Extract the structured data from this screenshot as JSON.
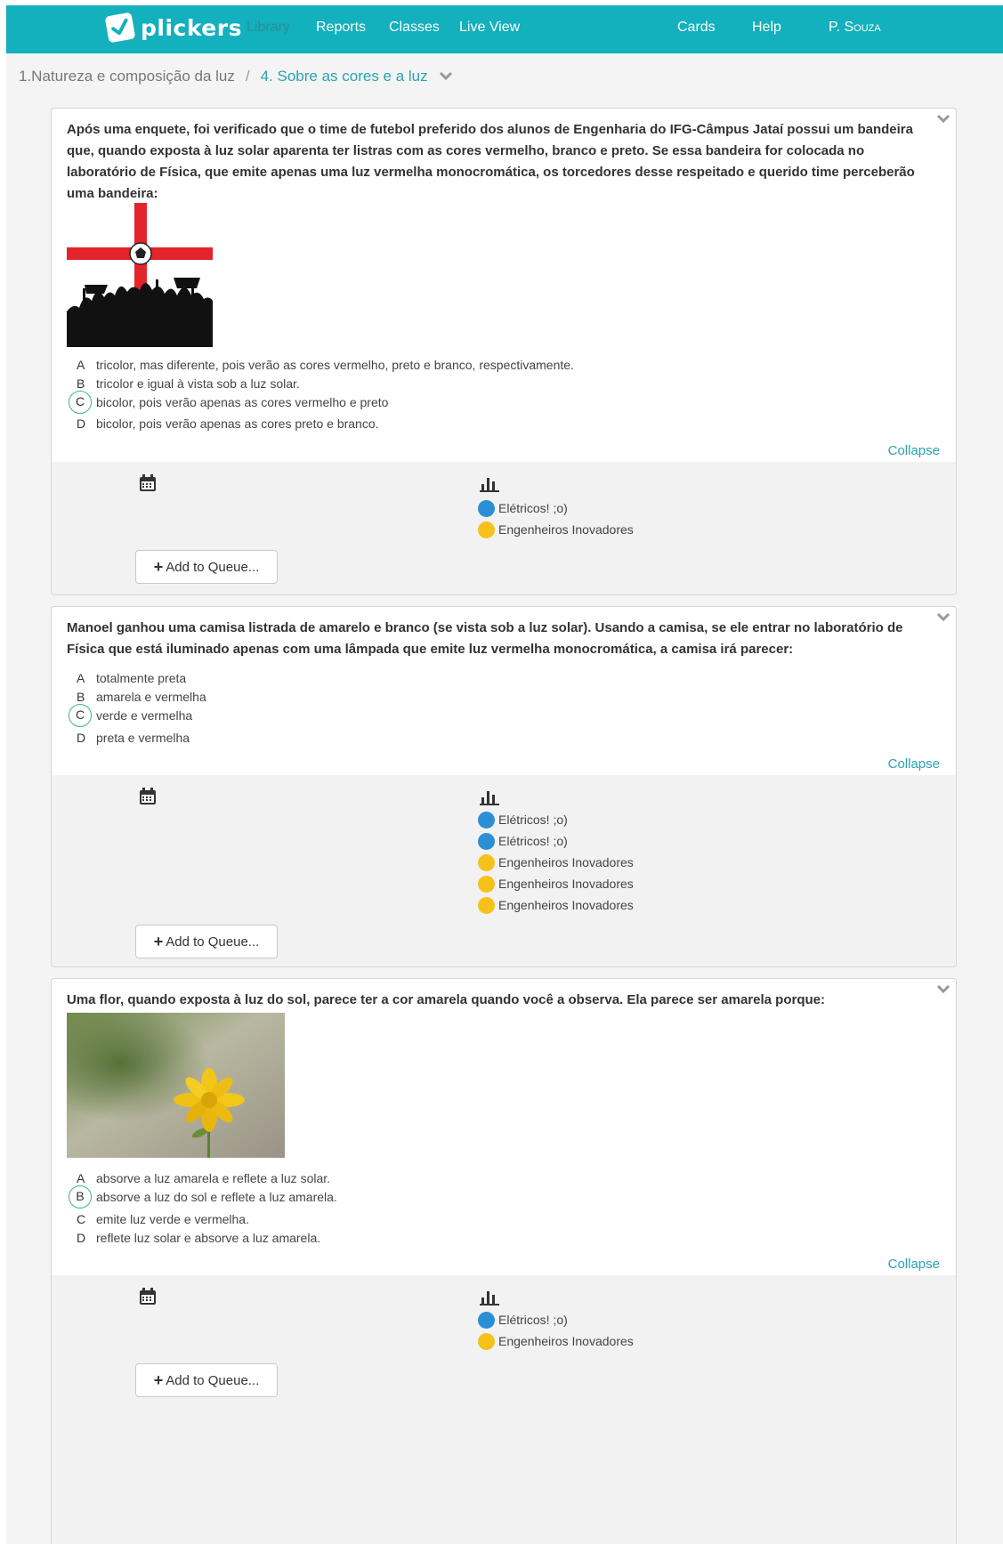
{
  "nav": {
    "logo": "plickers",
    "links": [
      "Library",
      "Reports",
      "Classes",
      "Live View"
    ],
    "right_links": [
      "Cards",
      "Help"
    ],
    "user": "P. Souza"
  },
  "breadcrumb": {
    "parent": "1.Natureza e composição da luz",
    "separator": "/",
    "current": "4. Sobre as cores e a luz"
  },
  "common": {
    "collapse": "Collapse",
    "add_to_queue": "Add to Queue...",
    "add_plus": "+"
  },
  "questions": [
    {
      "text": "Após uma enquete, foi verificado que o time de futebol preferido dos alunos de Engenharia do IFG-Câmpus Jataí possui um bandeira que, quando exposta à luz solar aparenta ter listras com as cores vermelho, branco e preto. Se essa bandeira for colocada no laboratório de Física, que emite apenas uma luz vermelha monocromática, os torcedores desse respeitado e querido time perceberão uma bandeira:",
      "choices": [
        {
          "letter": "A",
          "text": "tricolor, mas diferente, pois verão as cores vermelho, preto e branco, respectivamente."
        },
        {
          "letter": "B",
          "text": "tricolor e igual à vista sob a luz solar."
        },
        {
          "letter": "C",
          "text": "bicolor, pois verão apenas as cores vermelho e preto"
        },
        {
          "letter": "D",
          "text": "bicolor, pois verão apenas as cores preto e branco."
        }
      ],
      "correct": "C",
      "sections": [
        {
          "name": "Elétricos! ;o)",
          "color": "#2b8fd6"
        },
        {
          "name": "Engenheiros Inovadores",
          "color": "#f7c11c"
        }
      ]
    },
    {
      "text": "Manoel ganhou uma camisa listrada de amarelo e branco (se vista sob a luz solar). Usando a camisa, se ele entrar no laboratório de Física que está iluminado apenas com uma lâmpada que emite luz vermelha monocromática, a camisa irá parecer:",
      "choices": [
        {
          "letter": "A",
          "text": "totalmente preta"
        },
        {
          "letter": "B",
          "text": "amarela e vermelha"
        },
        {
          "letter": "C",
          "text": "verde e vermelha"
        },
        {
          "letter": "D",
          "text": "preta e vermelha"
        }
      ],
      "correct": "C",
      "sections": [
        {
          "name": "Elétricos! ;o)",
          "color": "#2b8fd6"
        },
        {
          "name": "Elétricos! ;o)",
          "color": "#2b8fd6"
        },
        {
          "name": "Engenheiros Inovadores",
          "color": "#f7c11c"
        },
        {
          "name": "Engenheiros Inovadores",
          "color": "#f7c11c"
        },
        {
          "name": "Engenheiros Inovadores",
          "color": "#f7c11c"
        }
      ]
    },
    {
      "text": "Uma flor, quando exposta à luz do sol, parece ter a cor amarela quando você a observa. Ela parece ser amarela porque:",
      "choices": [
        {
          "letter": "A",
          "text": "absorve a luz amarela e reflete a luz solar."
        },
        {
          "letter": "B",
          "text": "absorve a luz do sol e reflete a luz amarela."
        },
        {
          "letter": "C",
          "text": "emite luz verde e vermelha."
        },
        {
          "letter": "D",
          "text": "reflete luz solar e absorve a luz amarela."
        }
      ],
      "correct": "B",
      "sections": [
        {
          "name": "Elétricos! ;o)",
          "color": "#2b8fd6"
        },
        {
          "name": "Engenheiros Inovadores",
          "color": "#f7c11c"
        }
      ]
    }
  ]
}
